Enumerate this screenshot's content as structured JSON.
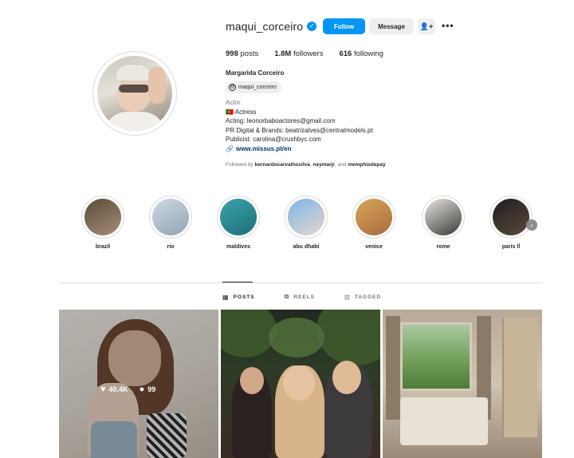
{
  "profile": {
    "username": "maqui_corceiro",
    "verified": true,
    "follow_label": "Follow",
    "message_label": "Message",
    "stats": {
      "posts_count": "998",
      "posts_label": "posts",
      "followers_count": "1.8M",
      "followers_label": "followers",
      "following_count": "616",
      "following_label": "following"
    },
    "full_name": "Margarida Corceiro",
    "threads_handle": "maqui_corceiro",
    "category": "Actor",
    "bio_lines": [
      "🇵🇹 Actress",
      "Acting: leonorbaboactores@gmail.com",
      "PR Digital & Brands: beatrizalves@centralmodels.pt",
      "Publicist: carolina@crushbyc.com"
    ],
    "website": "www.missus.pt/en",
    "followed_by": {
      "prefix": "Followed by",
      "user1": "bernardocarvalhosilva",
      "sep": ",",
      "user2": "neymarjr",
      "and": ", and",
      "user3": "memphisdepay"
    }
  },
  "highlights": [
    {
      "label": "brazil",
      "colors": [
        "#5b4a3a",
        "#a48f78"
      ]
    },
    {
      "label": "rio",
      "colors": [
        "#cfd8e0",
        "#8fa4b5"
      ]
    },
    {
      "label": "maldives",
      "colors": [
        "#3aa3a8",
        "#1f6f7a"
      ]
    },
    {
      "label": "abu dhabi",
      "colors": [
        "#7fb5e6",
        "#e3d7cf"
      ]
    },
    {
      "label": "venice",
      "colors": [
        "#d9a65a",
        "#a86b3d"
      ]
    },
    {
      "label": "rome",
      "colors": [
        "#e9e6e1",
        "#3b3a38"
      ]
    },
    {
      "label": "paris ll",
      "colors": [
        "#1e1d22",
        "#5a4a3a"
      ]
    }
  ],
  "tabs": [
    {
      "label": "POSTS",
      "icon": "grid-icon",
      "active": true
    },
    {
      "label": "REELS",
      "icon": "reels-icon",
      "active": false
    },
    {
      "label": "TAGGED",
      "icon": "tagged-icon",
      "active": false
    }
  ],
  "posts": [
    {
      "likes": "40.4K",
      "comments": "99",
      "hover": true
    },
    {
      "hover": false
    },
    {
      "hover": false
    }
  ],
  "colors": {
    "accent_blue": "#0095f6",
    "link_blue": "#00376b",
    "text_primary": "#262626",
    "text_secondary": "#737373",
    "border": "#dbdbdb"
  }
}
